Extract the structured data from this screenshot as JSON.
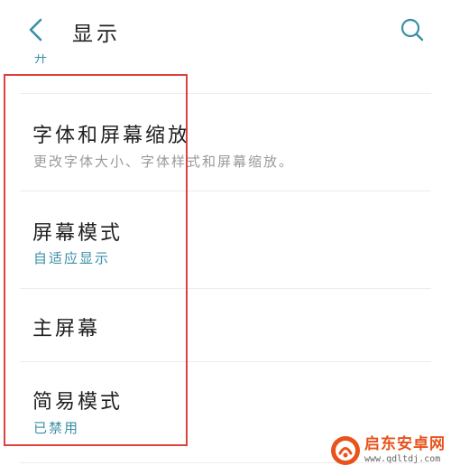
{
  "header": {
    "title": "显示",
    "back_icon": "chevron-left-icon",
    "search_icon": "search-icon",
    "accent_color": "#3a8fa6"
  },
  "partial_item": {
    "value": "开"
  },
  "settings_items": [
    {
      "title": "字体和屏幕缩放",
      "subtitle": "更改字体大小、字体样式和屏幕缩放。"
    },
    {
      "title": "屏幕模式",
      "subtitle": "自适应显示"
    },
    {
      "title": "主屏幕",
      "subtitle": ""
    },
    {
      "title": "简易模式",
      "subtitle": "已禁用"
    }
  ],
  "watermark": {
    "name": "启东安卓网",
    "url": "www.qdltdj.com"
  }
}
